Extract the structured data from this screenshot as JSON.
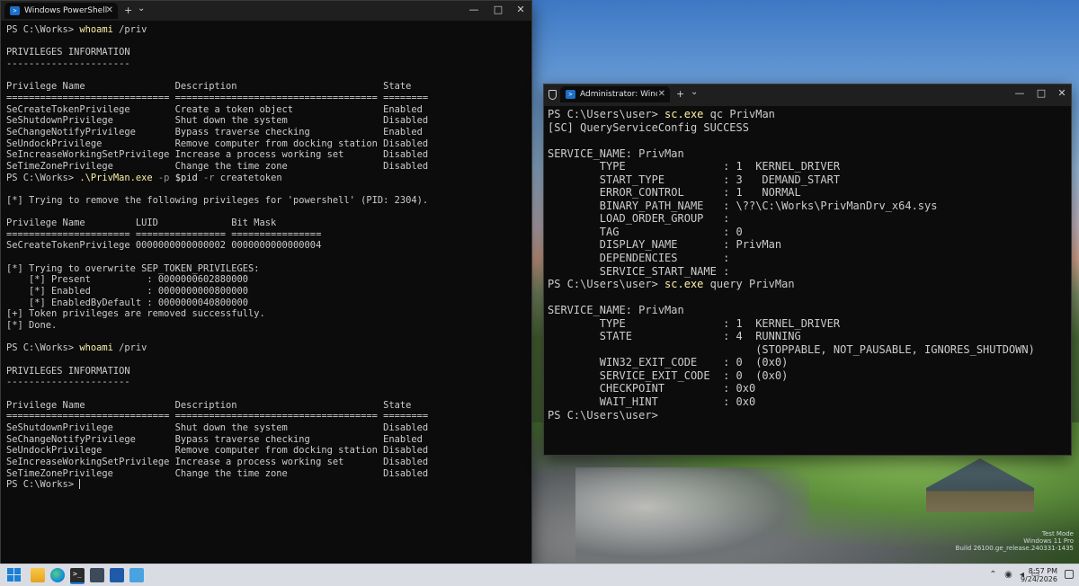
{
  "window_left": {
    "tab_title": "Windows PowerShell",
    "tab_icon": "powershell-icon",
    "new_tab": "+",
    "dropdown": "⌄",
    "minimize": "—",
    "maximize": "□",
    "close": "✕",
    "tab_close": "✕",
    "lines": [
      "PS C:\\Works> |whoami /priv",
      "",
      "PRIVILEGES INFORMATION",
      "----------------------",
      "",
      "Privilege Name                Description                          State",
      "============================= ==================================== ========",
      "SeCreateTokenPrivilege        Create a token object                Enabled",
      "SeShutdownPrivilege           Shut down the system                 Disabled",
      "SeChangeNotifyPrivilege       Bypass traverse checking             Enabled",
      "SeUndockPrivilege             Remove computer from docking station Disabled",
      "SeIncreaseWorkingSetPrivilege Increase a process working set       Disabled",
      "SeTimeZonePrivilege           Change the time zone                 Disabled",
      "PS C:\\Works> |.\\PrivMan.exe -p $pid -r createtoken",
      "",
      "[*] Trying to remove the following privileges for 'powershell' (PID: 2304).",
      "",
      "Privilege Name         LUID             Bit Mask",
      "====================== ================ ================",
      "SeCreateTokenPrivilege 0000000000000002 0000000000000004",
      "",
      "[*] Trying to overwrite SEP_TOKEN_PRIVILEGES:",
      "    [*] Present          : 0000000602880000",
      "    [*] Enabled          : 0000000000800000",
      "    [*] EnabledByDefault : 0000000040800000",
      "[+] Token privileges are removed successfully.",
      "[*] Done.",
      "",
      "PS C:\\Works> |whoami /priv",
      "",
      "PRIVILEGES INFORMATION",
      "----------------------",
      "",
      "Privilege Name                Description                          State",
      "============================= ==================================== ========",
      "SeShutdownPrivilege           Shut down the system                 Disabled",
      "SeChangeNotifyPrivilege       Bypass traverse checking             Enabled",
      "SeUndockPrivilege             Remove computer from docking station Disabled",
      "SeIncreaseWorkingSetPrivilege Increase a process working set       Disabled",
      "SeTimeZonePrivilege           Change the time zone                 Disabled",
      "PS C:\\Works> "
    ]
  },
  "window_right": {
    "tab_title": "Administrator: Windows Powe",
    "tab_icon": "powershell-icon",
    "new_tab": "+",
    "dropdown": "⌄",
    "minimize": "—",
    "maximize": "□",
    "close": "✕",
    "tab_close": "✕",
    "lines": [
      "PS C:\\Users\\user> |sc.exe qc PrivMan",
      "[SC] QueryServiceConfig SUCCESS",
      "",
      "SERVICE_NAME: PrivMan",
      "        TYPE               : 1  KERNEL_DRIVER",
      "        START_TYPE         : 3   DEMAND_START",
      "        ERROR_CONTROL      : 1   NORMAL",
      "        BINARY_PATH_NAME   : \\??\\C:\\Works\\PrivManDrv_x64.sys",
      "        LOAD_ORDER_GROUP   :",
      "        TAG                : 0",
      "        DISPLAY_NAME       : PrivMan",
      "        DEPENDENCIES       :",
      "        SERVICE_START_NAME :",
      "PS C:\\Users\\user> |sc.exe query PrivMan",
      "",
      "SERVICE_NAME: PrivMan",
      "        TYPE               : 1  KERNEL_DRIVER",
      "        STATE              : 4  RUNNING",
      "                                (STOPPABLE, NOT_PAUSABLE, IGNORES_SHUTDOWN)",
      "        WIN32_EXIT_CODE    : 0  (0x0)",
      "        SERVICE_EXIT_CODE  : 0  (0x0)",
      "        CHECKPOINT         : 0x0",
      "        WAIT_HINT          : 0x0",
      "PS C:\\Users\\user>"
    ]
  },
  "watermark": {
    "line1": "Test Mode",
    "line2": "Windows 11 Pro",
    "line3": "Build 26100.ge_release.240331-1435"
  },
  "taskbar": {
    "terminal_label": ">_",
    "time": "8:57 PM",
    "date": "9/24/2026",
    "tray": [
      "chevron-up-icon",
      "network-icon",
      "volume-icon",
      "battery-icon"
    ]
  },
  "colors": {
    "terminal_bg": "#0c0c0c",
    "terminal_fg": "#cccccc",
    "command": "#f9f1a5",
    "titlebar": "#1f1f1f",
    "taskbar": "#d9dde3"
  }
}
